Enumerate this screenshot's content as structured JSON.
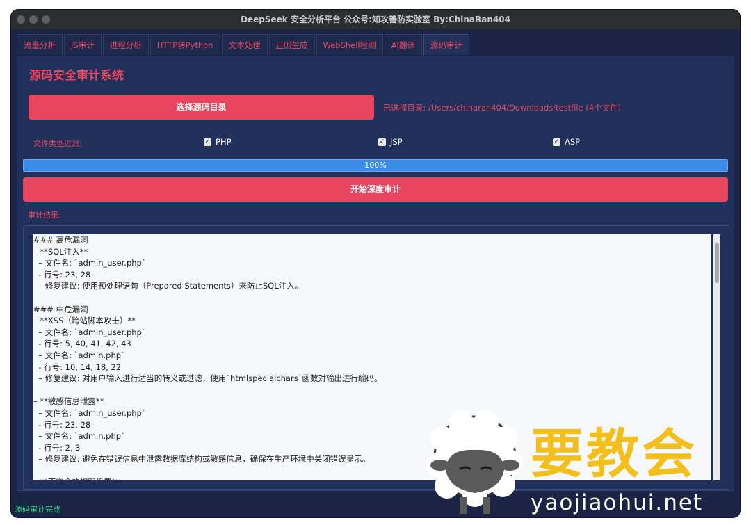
{
  "window": {
    "title": "DeepSeek 安全分析平台 公众号:知攻善防实验室 By:ChinaRan404"
  },
  "tabs": [
    {
      "label": "流量分析"
    },
    {
      "label": "JS审计"
    },
    {
      "label": "进程分析"
    },
    {
      "label": "HTTP转Python"
    },
    {
      "label": "文本处理"
    },
    {
      "label": "正则生成"
    },
    {
      "label": "WebShell检测"
    },
    {
      "label": "AI翻译"
    },
    {
      "label": "源码审计",
      "active": true
    }
  ],
  "panel": {
    "title": "源码安全审计系统",
    "select_dir_label": "选择源码目录",
    "selected_dir_text": "已选择目录: /Users/chinaran404/Downloads/testfile (4个文件)",
    "filter_label": "文件类型过滤:",
    "filters": [
      {
        "label": "PHP",
        "checked": true
      },
      {
        "label": "JSP",
        "checked": true
      },
      {
        "label": "ASP",
        "checked": true
      }
    ],
    "progress_text": "100%",
    "progress_value": 1.0,
    "start_label": "开始深度审计",
    "results_label": "审计结果:",
    "results_lines": [
      "### 高危漏洞",
      "– **SQL注入**",
      "  – 文件名: `admin_user.php`",
      "  - 行号: 23, 28",
      "  – 修复建议: 使用预处理语句（Prepared Statements）来防止SQL注入。",
      "",
      "### 中危漏洞",
      "– **XSS（跨站脚本攻击）**",
      "  – 文件名: `admin_user.php`",
      "  - 行号: 5, 40, 41, 42, 43",
      "  – 文件名: `admin.php`",
      "  - 行号: 10, 14, 18, 22",
      "  – 修复建议: 对用户输入进行适当的转义或过滤，使用`htmlspecialchars`函数对输出进行编码。",
      "",
      "– **敏感信息泄露**",
      "  – 文件名: `admin_user.php`",
      "  - 行号: 23, 28",
      "  – 文件名: `admin.php`",
      "  - 行号: 2, 3",
      "  – 修复建议: 避免在错误信息中泄露数据库结构或敏感信息，确保在生产环境中关闭错误显示。",
      "",
      "– **不安全的权限设置**"
    ]
  },
  "status_text": "源码审计完成",
  "watermark": {
    "brand": "要教会",
    "url": "yaojiaohui.net"
  },
  "colors": {
    "accent": "#e84560",
    "window_bg": "#1b2444",
    "panel_bg": "#21305a",
    "progress": "#3b8be8",
    "status": "#27d07a"
  }
}
